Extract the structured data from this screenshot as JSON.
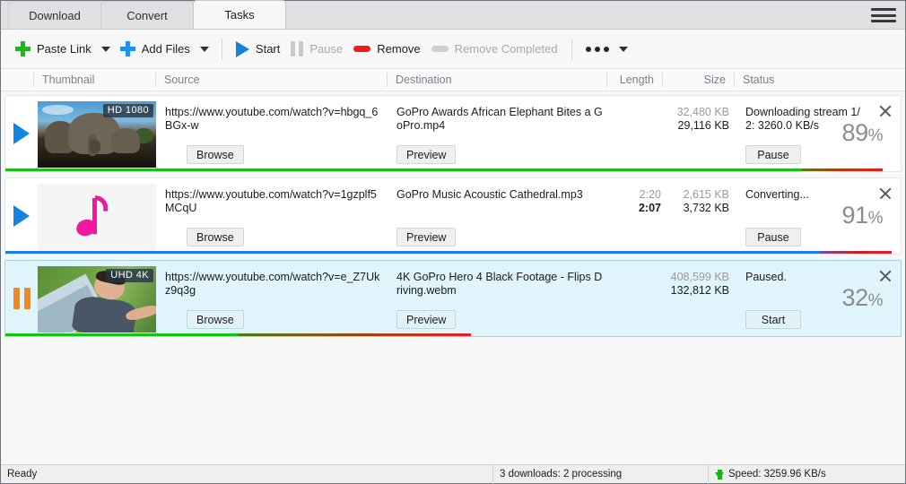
{
  "tabs": [
    {
      "label": "Download",
      "active": false
    },
    {
      "label": "Convert",
      "active": false
    },
    {
      "label": "Tasks",
      "active": true
    }
  ],
  "menu_icon": "hamburger-icon",
  "toolbar": {
    "paste_link": "Paste Link",
    "add_files": "Add Files",
    "start": "Start",
    "pause": "Pause",
    "remove": "Remove",
    "remove_completed": "Remove Completed",
    "more": "more-options"
  },
  "columns": {
    "thumbnail": "Thumbnail",
    "source": "Source",
    "destination": "Destination",
    "length": "Length",
    "size": "Size",
    "status": "Status"
  },
  "tasks": [
    {
      "state_icon": "play-icon",
      "selected": false,
      "quality_badge": "HD 1080",
      "thumb_kind": "elephant",
      "source": "https://www.youtube.com/watch?v=hbgq_6BGx-w",
      "destination": "GoPro Awards  African Elephant Bites a GoPro.mp4",
      "length_total": "",
      "length_done": "",
      "size_total": "32,480 KB",
      "size_done": "29,116 KB",
      "status": "Downloading stream 1/2: 3260.0 KB/s",
      "percent": "89",
      "percent_symbol": "%",
      "browse_label": "Browse",
      "preview_label": "Preview",
      "action_label": "Pause",
      "progress_pct": 89,
      "progress_color": "#16c016"
    },
    {
      "state_icon": "play-icon",
      "selected": false,
      "quality_badge": "",
      "thumb_kind": "audio",
      "source": "https://www.youtube.com/watch?v=1gzplf5MCqU",
      "destination": "GoPro Music  Acoustic Cathedral.mp3",
      "length_total": "2:20",
      "length_done": "2:07",
      "size_total": "2,615 KB",
      "size_done": "3,732 KB",
      "status": "Converting...",
      "percent": "91",
      "percent_symbol": "%",
      "browse_label": "Browse",
      "preview_label": "Preview",
      "action_label": "Pause",
      "progress_pct": 91,
      "progress_color": "#1b7ef0"
    },
    {
      "state_icon": "pause-icon",
      "selected": true,
      "quality_badge": "UHD 4K",
      "thumb_kind": "skydive",
      "source": "https://www.youtube.com/watch?v=e_Z7Ukz9q3g",
      "destination": "4K GoPro Hero 4 Black Footage - Flips Driving.webm",
      "length_total": "",
      "length_done": "",
      "size_total": "408,599 KB",
      "size_done": "132,812 KB",
      "status": "Paused.",
      "percent": "32",
      "percent_symbol": "%",
      "browse_label": "Browse",
      "preview_label": "Preview",
      "action_label": "Start",
      "progress_pct": 32,
      "progress_color": "#16c016"
    }
  ],
  "statusbar": {
    "ready": "Ready",
    "downloads": "3 downloads: 2 processing",
    "speed": "Speed: 3259.96 KB/s"
  },
  "colors": {
    "accent_blue": "#1383e0",
    "green": "#16c016",
    "orange": "#f2871d",
    "red": "#f01b1b",
    "selection": "#dff4fb"
  }
}
